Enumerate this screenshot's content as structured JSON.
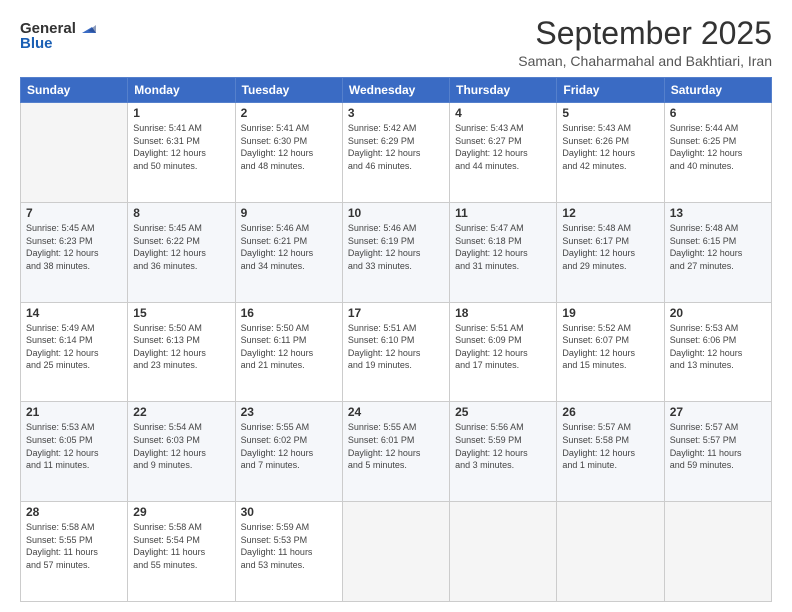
{
  "header": {
    "logo_general": "General",
    "logo_blue": "Blue",
    "title": "September 2025",
    "subtitle": "Saman, Chaharmahal and Bakhtiari, Iran"
  },
  "weekdays": [
    "Sunday",
    "Monday",
    "Tuesday",
    "Wednesday",
    "Thursday",
    "Friday",
    "Saturday"
  ],
  "weeks": [
    [
      {
        "day": "",
        "info": ""
      },
      {
        "day": "1",
        "info": "Sunrise: 5:41 AM\nSunset: 6:31 PM\nDaylight: 12 hours\nand 50 minutes."
      },
      {
        "day": "2",
        "info": "Sunrise: 5:41 AM\nSunset: 6:30 PM\nDaylight: 12 hours\nand 48 minutes."
      },
      {
        "day": "3",
        "info": "Sunrise: 5:42 AM\nSunset: 6:29 PM\nDaylight: 12 hours\nand 46 minutes."
      },
      {
        "day": "4",
        "info": "Sunrise: 5:43 AM\nSunset: 6:27 PM\nDaylight: 12 hours\nand 44 minutes."
      },
      {
        "day": "5",
        "info": "Sunrise: 5:43 AM\nSunset: 6:26 PM\nDaylight: 12 hours\nand 42 minutes."
      },
      {
        "day": "6",
        "info": "Sunrise: 5:44 AM\nSunset: 6:25 PM\nDaylight: 12 hours\nand 40 minutes."
      }
    ],
    [
      {
        "day": "7",
        "info": "Sunrise: 5:45 AM\nSunset: 6:23 PM\nDaylight: 12 hours\nand 38 minutes."
      },
      {
        "day": "8",
        "info": "Sunrise: 5:45 AM\nSunset: 6:22 PM\nDaylight: 12 hours\nand 36 minutes."
      },
      {
        "day": "9",
        "info": "Sunrise: 5:46 AM\nSunset: 6:21 PM\nDaylight: 12 hours\nand 34 minutes."
      },
      {
        "day": "10",
        "info": "Sunrise: 5:46 AM\nSunset: 6:19 PM\nDaylight: 12 hours\nand 33 minutes."
      },
      {
        "day": "11",
        "info": "Sunrise: 5:47 AM\nSunset: 6:18 PM\nDaylight: 12 hours\nand 31 minutes."
      },
      {
        "day": "12",
        "info": "Sunrise: 5:48 AM\nSunset: 6:17 PM\nDaylight: 12 hours\nand 29 minutes."
      },
      {
        "day": "13",
        "info": "Sunrise: 5:48 AM\nSunset: 6:15 PM\nDaylight: 12 hours\nand 27 minutes."
      }
    ],
    [
      {
        "day": "14",
        "info": "Sunrise: 5:49 AM\nSunset: 6:14 PM\nDaylight: 12 hours\nand 25 minutes."
      },
      {
        "day": "15",
        "info": "Sunrise: 5:50 AM\nSunset: 6:13 PM\nDaylight: 12 hours\nand 23 minutes."
      },
      {
        "day": "16",
        "info": "Sunrise: 5:50 AM\nSunset: 6:11 PM\nDaylight: 12 hours\nand 21 minutes."
      },
      {
        "day": "17",
        "info": "Sunrise: 5:51 AM\nSunset: 6:10 PM\nDaylight: 12 hours\nand 19 minutes."
      },
      {
        "day": "18",
        "info": "Sunrise: 5:51 AM\nSunset: 6:09 PM\nDaylight: 12 hours\nand 17 minutes."
      },
      {
        "day": "19",
        "info": "Sunrise: 5:52 AM\nSunset: 6:07 PM\nDaylight: 12 hours\nand 15 minutes."
      },
      {
        "day": "20",
        "info": "Sunrise: 5:53 AM\nSunset: 6:06 PM\nDaylight: 12 hours\nand 13 minutes."
      }
    ],
    [
      {
        "day": "21",
        "info": "Sunrise: 5:53 AM\nSunset: 6:05 PM\nDaylight: 12 hours\nand 11 minutes."
      },
      {
        "day": "22",
        "info": "Sunrise: 5:54 AM\nSunset: 6:03 PM\nDaylight: 12 hours\nand 9 minutes."
      },
      {
        "day": "23",
        "info": "Sunrise: 5:55 AM\nSunset: 6:02 PM\nDaylight: 12 hours\nand 7 minutes."
      },
      {
        "day": "24",
        "info": "Sunrise: 5:55 AM\nSunset: 6:01 PM\nDaylight: 12 hours\nand 5 minutes."
      },
      {
        "day": "25",
        "info": "Sunrise: 5:56 AM\nSunset: 5:59 PM\nDaylight: 12 hours\nand 3 minutes."
      },
      {
        "day": "26",
        "info": "Sunrise: 5:57 AM\nSunset: 5:58 PM\nDaylight: 12 hours\nand 1 minute."
      },
      {
        "day": "27",
        "info": "Sunrise: 5:57 AM\nSunset: 5:57 PM\nDaylight: 11 hours\nand 59 minutes."
      }
    ],
    [
      {
        "day": "28",
        "info": "Sunrise: 5:58 AM\nSunset: 5:55 PM\nDaylight: 11 hours\nand 57 minutes."
      },
      {
        "day": "29",
        "info": "Sunrise: 5:58 AM\nSunset: 5:54 PM\nDaylight: 11 hours\nand 55 minutes."
      },
      {
        "day": "30",
        "info": "Sunrise: 5:59 AM\nSunset: 5:53 PM\nDaylight: 11 hours\nand 53 minutes."
      },
      {
        "day": "",
        "info": ""
      },
      {
        "day": "",
        "info": ""
      },
      {
        "day": "",
        "info": ""
      },
      {
        "day": "",
        "info": ""
      }
    ]
  ]
}
